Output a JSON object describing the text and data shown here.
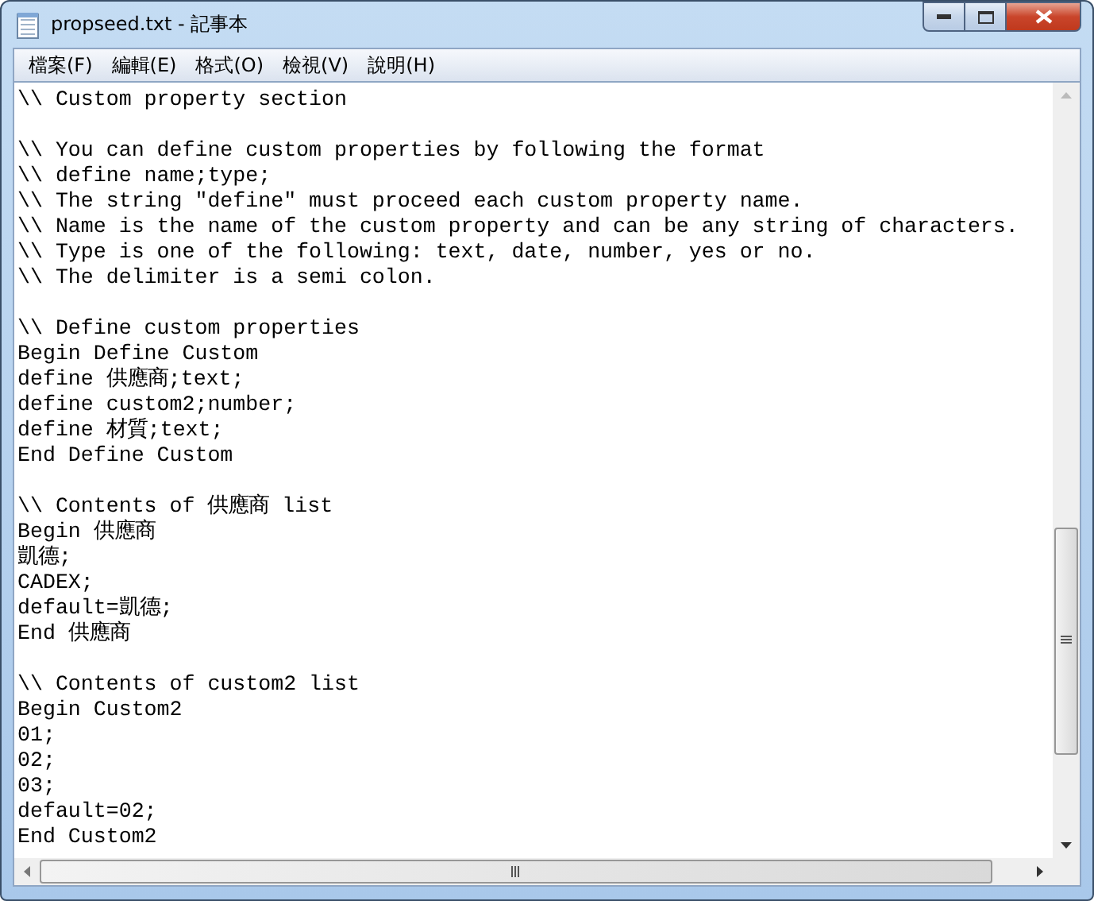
{
  "window": {
    "title": "propseed.txt - 記事本"
  },
  "menu": [
    "檔案(F)",
    "編輯(E)",
    "格式(O)",
    "檢視(V)",
    "說明(H)"
  ],
  "editor": {
    "paragraphs": [
      [
        "\\\\ Custom property section"
      ],
      [
        "\\\\ You can define custom properties by following the format",
        "\\\\ define name;type;",
        "\\\\ The string \"define\" must proceed each custom property name.",
        "\\\\ Name is the name of the custom property and can be any string of characters.",
        "\\\\ Type is one of the following: text, date, number, yes or no.",
        "\\\\ The delimiter is a semi colon."
      ],
      [
        "\\\\ Define custom properties",
        "Begin Define Custom",
        "define 供應商;text;",
        "define custom2;number;",
        "define 材質;text;",
        "End Define Custom"
      ],
      [
        "\\\\ Contents of 供應商 list",
        "Begin 供應商",
        "凱德;",
        "CADEX;",
        "default=凱德;",
        "End 供應商"
      ],
      [
        "\\\\ Contents of custom2 list",
        "Begin Custom2",
        "01;",
        "02;",
        "03;",
        "default=02;",
        "End Custom2"
      ]
    ]
  }
}
